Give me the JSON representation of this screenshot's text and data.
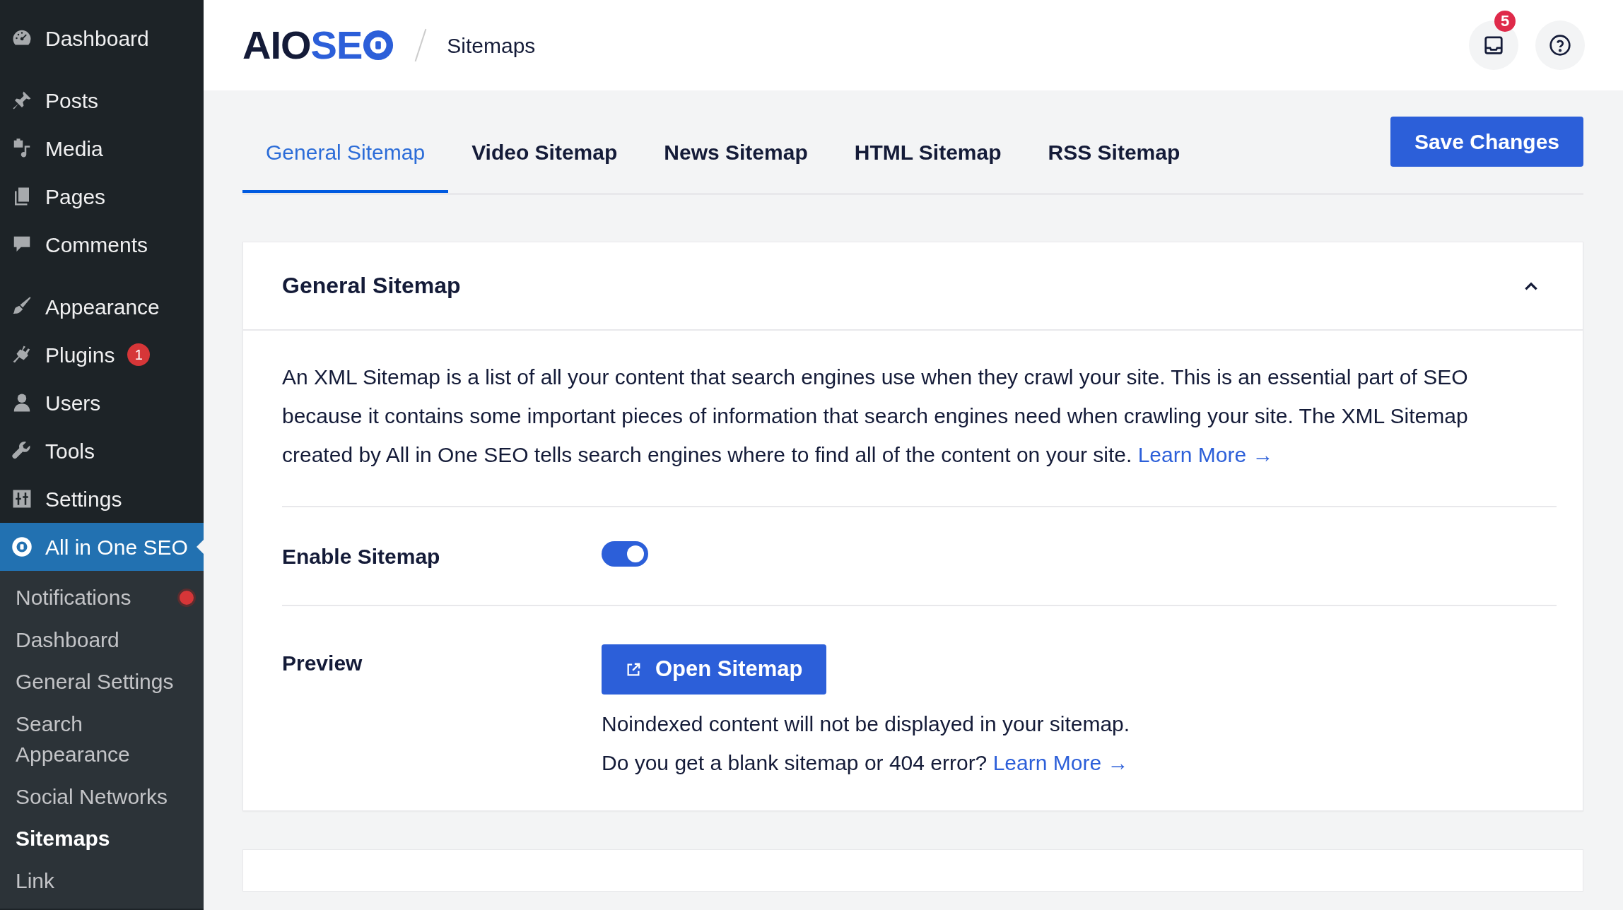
{
  "sidebar": {
    "items": [
      {
        "label": "Dashboard",
        "selected": false
      },
      {
        "label": "Posts",
        "selected": false
      },
      {
        "label": "Media",
        "selected": false
      },
      {
        "label": "Pages",
        "selected": false
      },
      {
        "label": "Comments",
        "selected": false
      },
      {
        "label": "Appearance",
        "selected": false
      },
      {
        "label": "Plugins",
        "selected": false,
        "badge": "1"
      },
      {
        "label": "Users",
        "selected": false
      },
      {
        "label": "Tools",
        "selected": false
      },
      {
        "label": "Settings",
        "selected": false
      },
      {
        "label": "All in One SEO",
        "selected": true,
        "children": [
          {
            "label": "Notifications",
            "selected": false,
            "dot": true
          },
          {
            "label": "Dashboard",
            "selected": false
          },
          {
            "label": "General Settings",
            "selected": false
          },
          {
            "label": "Search Appearance",
            "selected": false
          },
          {
            "label": "Social Networks",
            "selected": false
          },
          {
            "label": "Sitemaps",
            "selected": true
          },
          {
            "label": "Link",
            "selected": false
          }
        ]
      }
    ]
  },
  "header": {
    "logo": [
      {
        "text": "AIO",
        "color": "#141b38"
      },
      {
        "text": "SE",
        "color": "#2c5fd9"
      }
    ],
    "breadcrumb": "Sitemaps",
    "notification_count": "5"
  },
  "tabs": [
    {
      "label": "General Sitemap",
      "selected": true
    },
    {
      "label": "Video Sitemap",
      "selected": false
    },
    {
      "label": "News Sitemap",
      "selected": false
    },
    {
      "label": "HTML Sitemap",
      "selected": false
    },
    {
      "label": "RSS Sitemap",
      "selected": false
    }
  ],
  "save_button": "Save Changes",
  "card": {
    "title": "General Sitemap",
    "expanded": true,
    "description": "An XML Sitemap is a list of all your content that search engines use when they crawl your site. This is an essential part of SEO because it contains some important pieces of information that search engines need when crawling your site. The XML Sitemap created by All in One SEO tells search engines where to find all of the content on your site.",
    "description_link": "Learn More →",
    "enable": {
      "label": "Enable Sitemap",
      "on": true
    },
    "preview": {
      "label": "Preview",
      "button": "Open Sitemap",
      "notes": [
        {
          "text": "Noindexed content will not be displayed in your sitemap."
        },
        {
          "text": "Do you get a blank sitemap or 404 error?",
          "link": "Learn More →"
        }
      ]
    }
  }
}
